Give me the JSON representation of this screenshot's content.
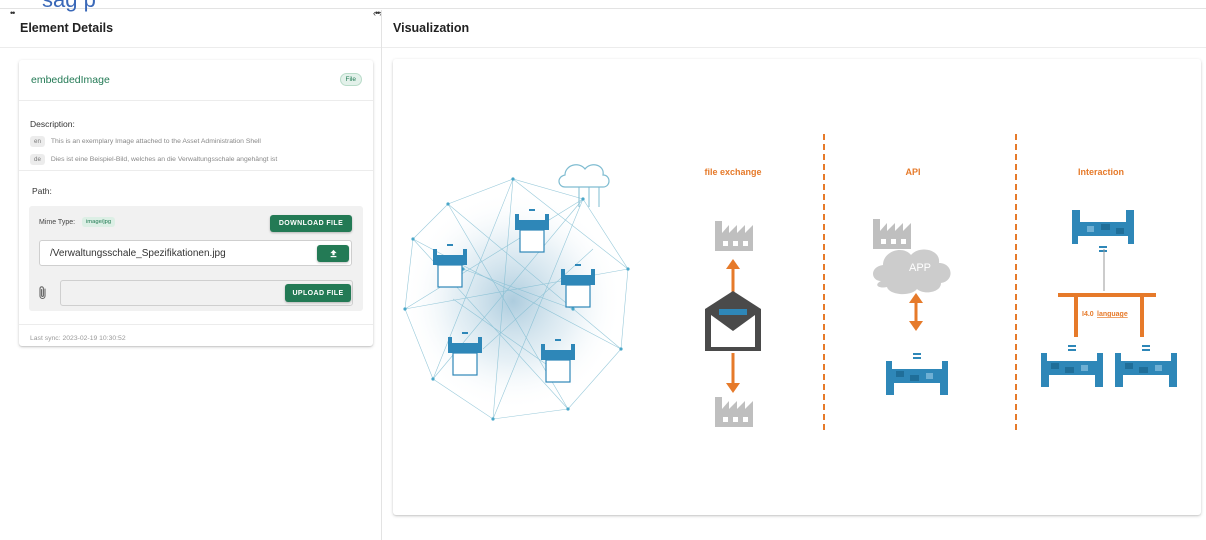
{
  "top_fragment": "sag p",
  "left_panel": {
    "title": "Element Details",
    "card": {
      "name": "embeddedImage",
      "type_chip": "File",
      "description_label": "Description:",
      "descriptions": [
        {
          "lang": "en",
          "text": "This is an exemplary Image attached to the Asset Administration Shell"
        },
        {
          "lang": "de",
          "text": "Dies ist eine Beispiel-Bild, welches an die Verwaltungsschale angehängt ist"
        }
      ],
      "path_label": "Path:",
      "mime_label": "Mime Type:",
      "mime_value": "image/jpg",
      "download_button": "DOWNLOAD FILE",
      "path_value": "/Verwaltungsschale_Spezifikationen.jpg",
      "upload_button": "UPLOAD FILE",
      "last_sync": "Last sync: 2023-02-19 10:30:52"
    }
  },
  "right_panel": {
    "title": "Visualization",
    "image": {
      "label_file_exchange": "file exchange",
      "label_api": "API",
      "label_interaction": "Interaction",
      "label_app": "APP",
      "label_i40": "I4.0",
      "label_language": "language"
    }
  },
  "colors": {
    "accent_green": "#237a55",
    "orange": "#e67a2a",
    "machine_blue": "#2e87b8"
  }
}
